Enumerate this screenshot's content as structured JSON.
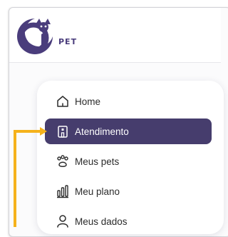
{
  "brand": {
    "name": "PET",
    "accent": "#463d6d",
    "logo_color": "#4a3d7c"
  },
  "sidebar": {
    "items": [
      {
        "label": "Home",
        "icon": "home-icon",
        "active": false
      },
      {
        "label": "Atendimento",
        "icon": "building-icon",
        "active": true
      },
      {
        "label": "Meus pets",
        "icon": "paw-icon",
        "active": false
      },
      {
        "label": "Meu plano",
        "icon": "bar-chart-icon",
        "active": false
      },
      {
        "label": "Meus dados",
        "icon": "user-icon",
        "active": false
      }
    ]
  },
  "annotation": {
    "color": "#f5b21b",
    "icon": "callout-arrow-icon"
  }
}
